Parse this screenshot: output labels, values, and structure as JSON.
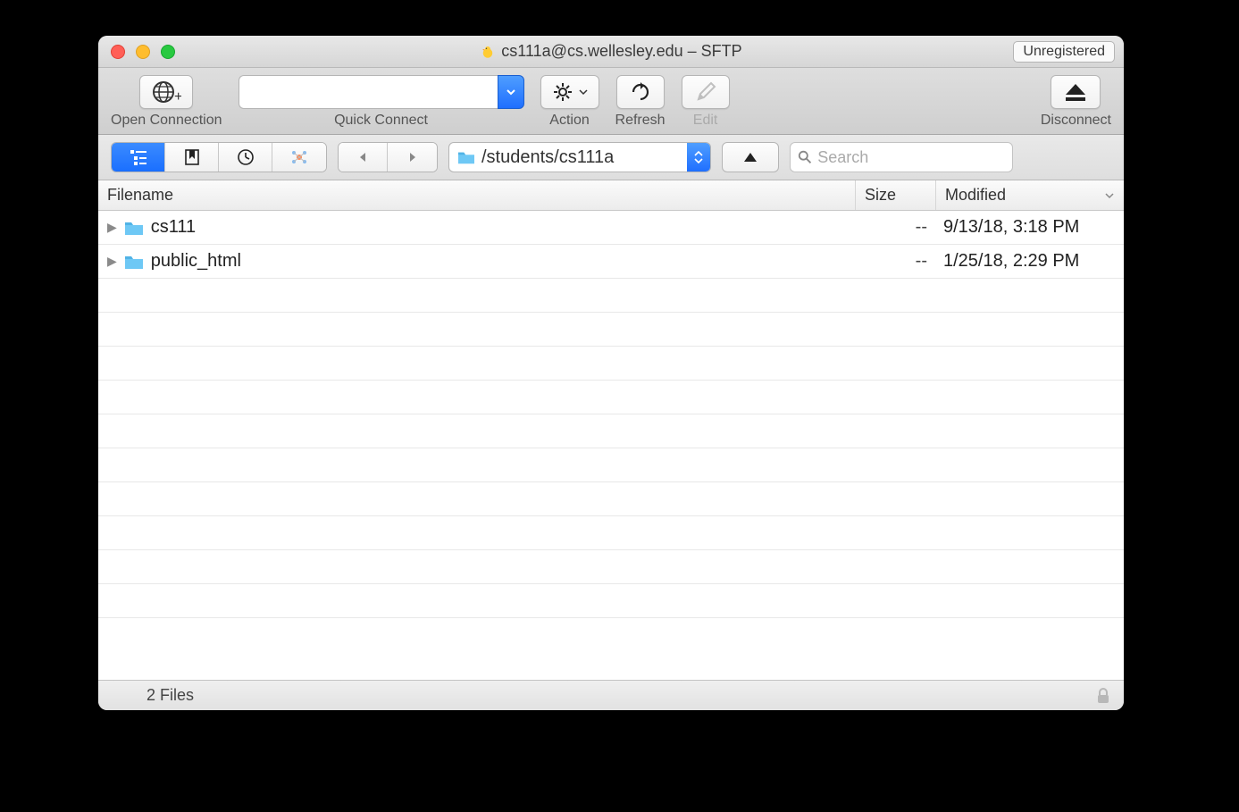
{
  "title": "cs111a@cs.wellesley.edu – SFTP",
  "unregistered_label": "Unregistered",
  "toolbar": {
    "open_connection": "Open Connection",
    "quick_connect": "Quick Connect",
    "quick_connect_value": "",
    "action": "Action",
    "refresh": "Refresh",
    "edit": "Edit",
    "disconnect": "Disconnect"
  },
  "path": "/students/cs111a",
  "search_placeholder": "Search",
  "columns": {
    "filename": "Filename",
    "size": "Size",
    "modified": "Modified"
  },
  "files": [
    {
      "name": "cs111",
      "size": "--",
      "modified": "9/13/18, 3:18 PM"
    },
    {
      "name": "public_html",
      "size": "--",
      "modified": "1/25/18, 2:29 PM"
    }
  ],
  "status": "2 Files"
}
